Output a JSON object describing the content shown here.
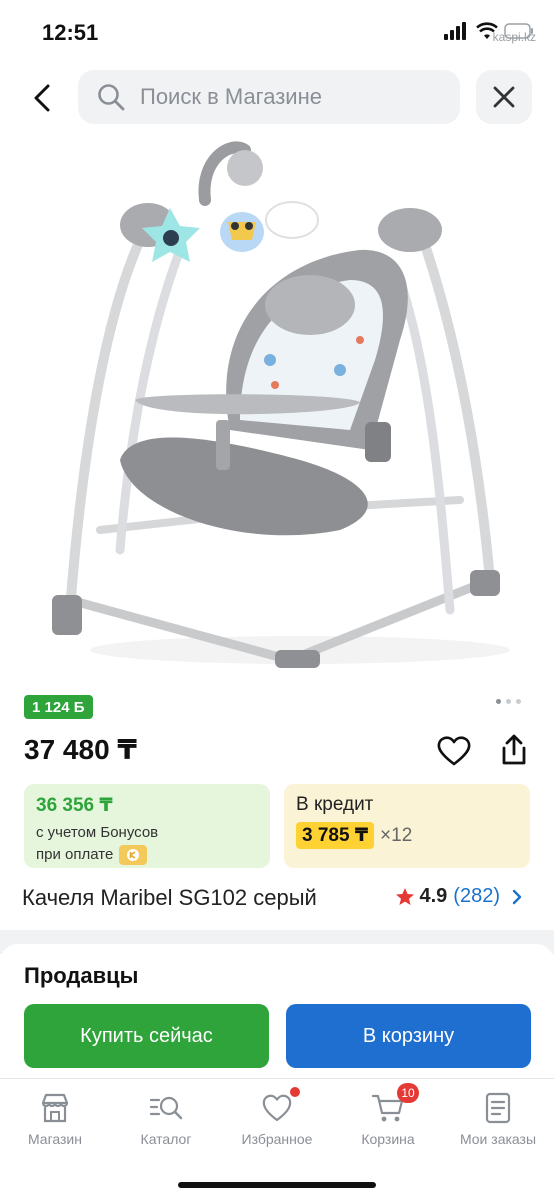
{
  "status_bar": {
    "time": "12:51",
    "site": "kaspi.kz"
  },
  "header": {
    "search_placeholder": "Поиск в Магазине"
  },
  "product": {
    "bonus_badge": "1 124 Б",
    "price": "37 480 ₸",
    "title": "Качеля Maribel SG102 серый",
    "rating": "4.9",
    "reviews": "(282)"
  },
  "bonus_card": {
    "price": "36 356 ₸",
    "line1": "с учетом Бонусов",
    "line2": "при оплате"
  },
  "credit_card": {
    "title": "В кредит",
    "monthly": "3 785 ₸",
    "multiplier": "×12"
  },
  "sellers": {
    "title": "Продавцы",
    "buy_now": "Купить сейчас",
    "to_cart": "В корзину"
  },
  "nav": [
    {
      "label": "Магазин",
      "icon": "shop-icon"
    },
    {
      "label": "Каталог",
      "icon": "catalog-search-icon"
    },
    {
      "label": "Избранное",
      "icon": "heart-icon"
    },
    {
      "label": "Корзина",
      "icon": "cart-icon",
      "badge": "10"
    },
    {
      "label": "Мои заказы",
      "icon": "orders-icon"
    }
  ],
  "colors": {
    "green": "#2ea43b",
    "blue": "#1f6fd1",
    "red": "#e53935",
    "yellow": "#ffd233"
  }
}
